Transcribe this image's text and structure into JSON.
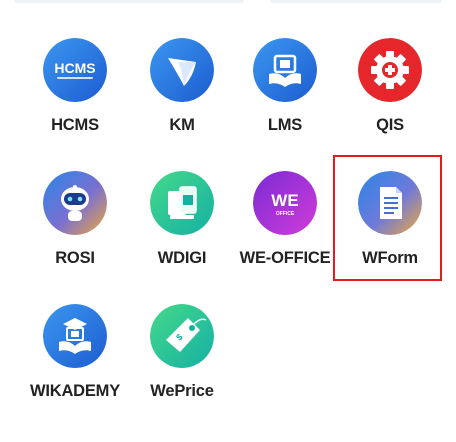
{
  "apps": [
    {
      "label": "HCMS",
      "icon": "hcms-logo-icon",
      "icon_text": "HCMS"
    },
    {
      "label": "KM",
      "icon": "km-leaf-icon"
    },
    {
      "label": "LMS",
      "icon": "lms-book-icon"
    },
    {
      "label": "QIS",
      "icon": "qis-gear-icon"
    },
    {
      "label": "ROSI",
      "icon": "rosi-robot-icon"
    },
    {
      "label": "WDIGI",
      "icon": "wdigi-device-icon"
    },
    {
      "label": "WE-OFFICE",
      "icon": "we-office-logo-icon",
      "icon_text": "WE",
      "icon_subtext": "OFFICE"
    },
    {
      "label": "WForm",
      "icon": "wform-document-icon"
    },
    {
      "label": "WIKADEMY",
      "icon": "wikademy-graduation-icon"
    },
    {
      "label": "WePrice",
      "icon": "weprice-tag-icon"
    }
  ],
  "highlighted_app": "WForm",
  "colors": {
    "highlight_border": "#e01e1e",
    "label": "#222222",
    "blue_gradient_start": "#2a86e8",
    "blue_gradient_end": "#1f5fd1",
    "qis_red": "#e5262a",
    "green_gradient_start": "#3fd48a",
    "green_gradient_end": "#17b6a0",
    "purple_gradient_start": "#8a2bd6",
    "purple_gradient_end": "#c63ad8",
    "orange_gradient": "#f2a93b"
  }
}
